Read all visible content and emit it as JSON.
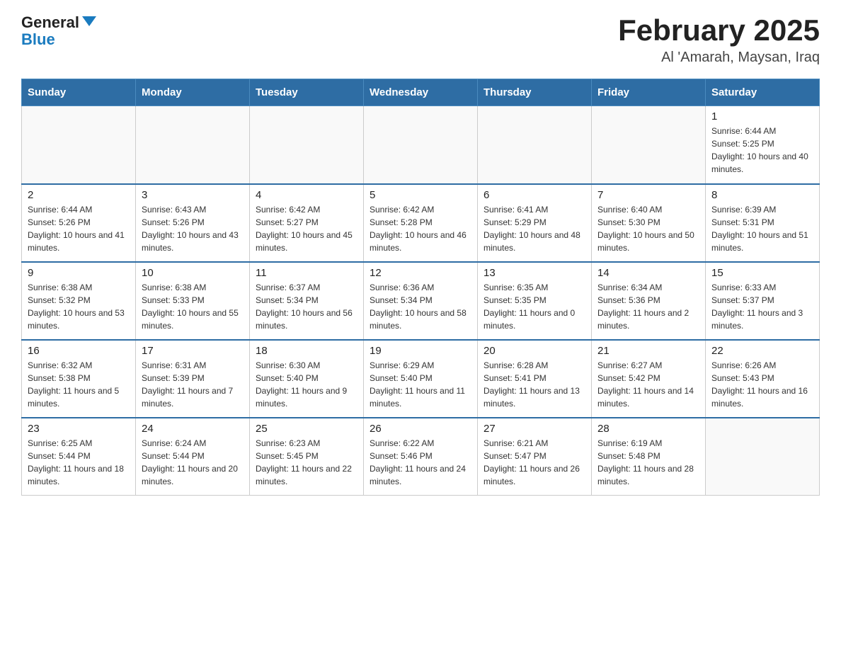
{
  "logo": {
    "general": "General",
    "blue": "Blue"
  },
  "title": "February 2025",
  "subtitle": "Al 'Amarah, Maysan, Iraq",
  "weekdays": [
    "Sunday",
    "Monday",
    "Tuesday",
    "Wednesday",
    "Thursday",
    "Friday",
    "Saturday"
  ],
  "weeks": [
    [
      {
        "day": "",
        "info": ""
      },
      {
        "day": "",
        "info": ""
      },
      {
        "day": "",
        "info": ""
      },
      {
        "day": "",
        "info": ""
      },
      {
        "day": "",
        "info": ""
      },
      {
        "day": "",
        "info": ""
      },
      {
        "day": "1",
        "info": "Sunrise: 6:44 AM\nSunset: 5:25 PM\nDaylight: 10 hours and 40 minutes."
      }
    ],
    [
      {
        "day": "2",
        "info": "Sunrise: 6:44 AM\nSunset: 5:26 PM\nDaylight: 10 hours and 41 minutes."
      },
      {
        "day": "3",
        "info": "Sunrise: 6:43 AM\nSunset: 5:26 PM\nDaylight: 10 hours and 43 minutes."
      },
      {
        "day": "4",
        "info": "Sunrise: 6:42 AM\nSunset: 5:27 PM\nDaylight: 10 hours and 45 minutes."
      },
      {
        "day": "5",
        "info": "Sunrise: 6:42 AM\nSunset: 5:28 PM\nDaylight: 10 hours and 46 minutes."
      },
      {
        "day": "6",
        "info": "Sunrise: 6:41 AM\nSunset: 5:29 PM\nDaylight: 10 hours and 48 minutes."
      },
      {
        "day": "7",
        "info": "Sunrise: 6:40 AM\nSunset: 5:30 PM\nDaylight: 10 hours and 50 minutes."
      },
      {
        "day": "8",
        "info": "Sunrise: 6:39 AM\nSunset: 5:31 PM\nDaylight: 10 hours and 51 minutes."
      }
    ],
    [
      {
        "day": "9",
        "info": "Sunrise: 6:38 AM\nSunset: 5:32 PM\nDaylight: 10 hours and 53 minutes."
      },
      {
        "day": "10",
        "info": "Sunrise: 6:38 AM\nSunset: 5:33 PM\nDaylight: 10 hours and 55 minutes."
      },
      {
        "day": "11",
        "info": "Sunrise: 6:37 AM\nSunset: 5:34 PM\nDaylight: 10 hours and 56 minutes."
      },
      {
        "day": "12",
        "info": "Sunrise: 6:36 AM\nSunset: 5:34 PM\nDaylight: 10 hours and 58 minutes."
      },
      {
        "day": "13",
        "info": "Sunrise: 6:35 AM\nSunset: 5:35 PM\nDaylight: 11 hours and 0 minutes."
      },
      {
        "day": "14",
        "info": "Sunrise: 6:34 AM\nSunset: 5:36 PM\nDaylight: 11 hours and 2 minutes."
      },
      {
        "day": "15",
        "info": "Sunrise: 6:33 AM\nSunset: 5:37 PM\nDaylight: 11 hours and 3 minutes."
      }
    ],
    [
      {
        "day": "16",
        "info": "Sunrise: 6:32 AM\nSunset: 5:38 PM\nDaylight: 11 hours and 5 minutes."
      },
      {
        "day": "17",
        "info": "Sunrise: 6:31 AM\nSunset: 5:39 PM\nDaylight: 11 hours and 7 minutes."
      },
      {
        "day": "18",
        "info": "Sunrise: 6:30 AM\nSunset: 5:40 PM\nDaylight: 11 hours and 9 minutes."
      },
      {
        "day": "19",
        "info": "Sunrise: 6:29 AM\nSunset: 5:40 PM\nDaylight: 11 hours and 11 minutes."
      },
      {
        "day": "20",
        "info": "Sunrise: 6:28 AM\nSunset: 5:41 PM\nDaylight: 11 hours and 13 minutes."
      },
      {
        "day": "21",
        "info": "Sunrise: 6:27 AM\nSunset: 5:42 PM\nDaylight: 11 hours and 14 minutes."
      },
      {
        "day": "22",
        "info": "Sunrise: 6:26 AM\nSunset: 5:43 PM\nDaylight: 11 hours and 16 minutes."
      }
    ],
    [
      {
        "day": "23",
        "info": "Sunrise: 6:25 AM\nSunset: 5:44 PM\nDaylight: 11 hours and 18 minutes."
      },
      {
        "day": "24",
        "info": "Sunrise: 6:24 AM\nSunset: 5:44 PM\nDaylight: 11 hours and 20 minutes."
      },
      {
        "day": "25",
        "info": "Sunrise: 6:23 AM\nSunset: 5:45 PM\nDaylight: 11 hours and 22 minutes."
      },
      {
        "day": "26",
        "info": "Sunrise: 6:22 AM\nSunset: 5:46 PM\nDaylight: 11 hours and 24 minutes."
      },
      {
        "day": "27",
        "info": "Sunrise: 6:21 AM\nSunset: 5:47 PM\nDaylight: 11 hours and 26 minutes."
      },
      {
        "day": "28",
        "info": "Sunrise: 6:19 AM\nSunset: 5:48 PM\nDaylight: 11 hours and 28 minutes."
      },
      {
        "day": "",
        "info": ""
      }
    ]
  ]
}
